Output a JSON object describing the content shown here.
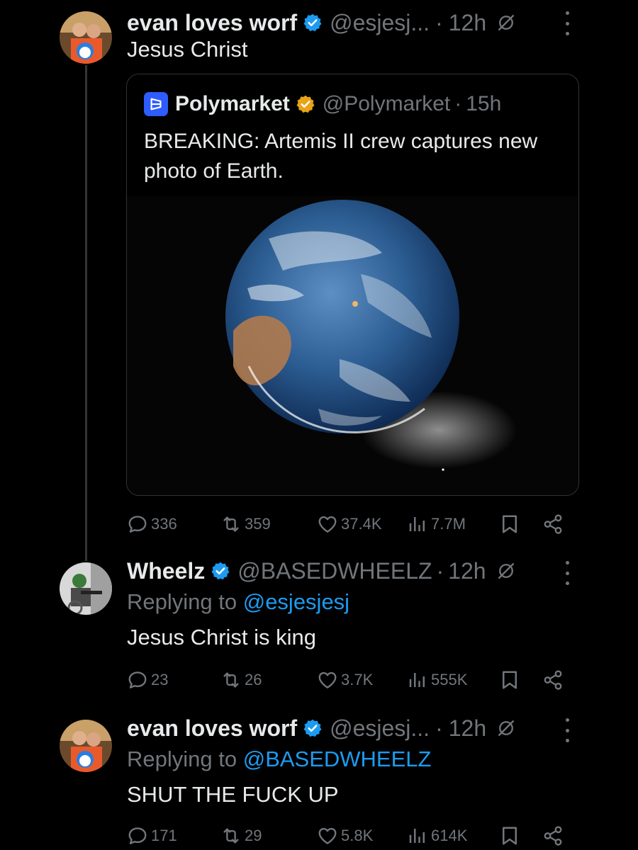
{
  "tweets": [
    {
      "display_name": "evan loves worf",
      "handle": "@esjesj...",
      "separator": "·",
      "time": "12h",
      "text": "Jesus Christ",
      "stats": {
        "replies": "336",
        "reposts": "359",
        "likes": "37.4K",
        "views": "7.7M"
      },
      "quote": {
        "display_name": "Polymarket",
        "handle": "@Polymarket",
        "separator": "·",
        "time": "15h",
        "text": "BREAKING: Artemis II crew captures new photo of Earth.",
        "badge_color": "#e8a317",
        "logo_color": "#2e5cff"
      }
    },
    {
      "display_name": "Wheelz",
      "handle": "@BASEDWHEELZ",
      "separator": "·",
      "time": "12h",
      "replying_prefix": "Replying to",
      "replying_to": "@esjesjesj",
      "text": "Jesus Christ is king",
      "stats": {
        "replies": "23",
        "reposts": "26",
        "likes": "3.7K",
        "views": "555K"
      }
    },
    {
      "display_name": "evan loves worf",
      "handle": "@esjesj...",
      "separator": "·",
      "time": "12h",
      "replying_prefix": "Replying to",
      "replying_to": "@BASEDWHEELZ",
      "text": "SHUT THE FUCK UP",
      "stats": {
        "replies": "171",
        "reposts": "29",
        "likes": "5.8K",
        "views": "614K"
      }
    }
  ],
  "colors": {
    "background": "#000000",
    "text": "#e7e9ea",
    "muted": "#71767b",
    "link": "#1d9bf0",
    "verified_blue": "#1d9bf0"
  },
  "icons": [
    "verified-badge-icon",
    "mute-icon",
    "more-icon",
    "reply-icon",
    "repost-icon",
    "like-icon",
    "views-icon",
    "bookmark-icon",
    "share-icon"
  ]
}
